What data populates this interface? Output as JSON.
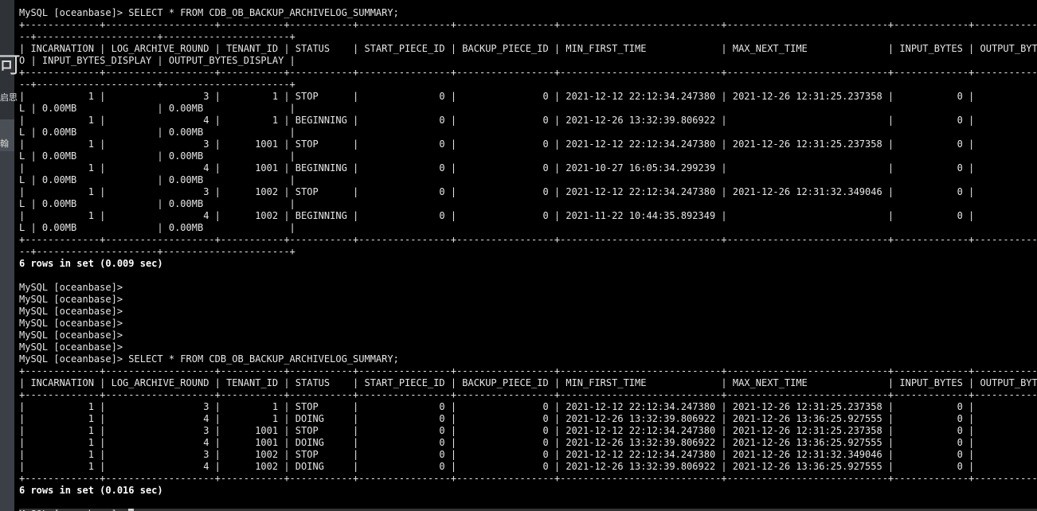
{
  "colors": {
    "background": "#000000",
    "text": "#e6e6e6",
    "left_strip": "#3a3f44",
    "highlight_row": "#333333"
  },
  "left_strip": {
    "glyph_1": "可",
    "glyph_2": "启思",
    "glyph_3": "翰"
  },
  "terminal": {
    "lines": [
      "MySQL [oceanbase]> SELECT * FROM CDB_OB_BACKUP_ARCHIVELOG_SUMMARY;",
      "+-------------+-------------------+-----------+-----------+----------------+-----------------+----------------------------+----------------------------+-------------+--------------+----",
      "--+---------------------+----------------------+",
      "| INCARNATION | LOG_ARCHIVE_ROUND | TENANT_ID | STATUS    | START_PIECE_ID | BACKUP_PIECE_ID | MIN_FIRST_TIME             | MAX_NEXT_TIME              | INPUT_BYTES | OUTPUT_BYTES | C",
      "O | INPUT_BYTES_DISPLAY | OUTPUT_BYTES_DISPLAY |",
      "+-------------+-------------------+-----------+-----------+----------------+-----------------+----------------------------+----------------------------+-------------+--------------+----",
      "--+---------------------+----------------------+",
      "|           1 |                 3 |         1 | STOP      |              0 |               0 | 2021-12-12 22:12:34.247380 | 2021-12-26 12:31:25.237358 |           0 |            0 |",
      "L | 0.00MB              | 0.00MB               |",
      "|           1 |                 4 |         1 | BEGINNING |              0 |               0 | 2021-12-26 13:32:39.806922 |                            |           0 |            0 |",
      "L | 0.00MB              | 0.00MB               |",
      "|           1 |                 3 |      1001 | STOP      |              0 |               0 | 2021-12-12 22:12:34.247380 | 2021-12-26 12:31:25.237358 |           0 |            0 |",
      "L | 0.00MB              | 0.00MB               |",
      "|           1 |                 4 |      1001 | BEGINNING |              0 |               0 | 2021-10-27 16:05:34.299239 |                            |           0 |            0 |",
      "L | 0.00MB              | 0.00MB               |",
      "|           1 |                 3 |      1002 | STOP      |              0 |               0 | 2021-12-12 22:12:34.247380 | 2021-12-26 12:31:32.349046 |           0 |            0 |",
      "L | 0.00MB              | 0.00MB               |",
      "|           1 |                 4 |      1002 | BEGINNING |              0 |               0 | 2021-11-22 10:44:35.892349 |                            |           0 |            0 |",
      "L | 0.00MB              | 0.00MB               |",
      "+-------------+-------------------+-----------+-----------+----------------+-----------------+----------------------------+----------------------------+-------------+--------------+----",
      "--+---------------------+----------------------+",
      "6 rows in set (0.009 sec)",
      "",
      "MySQL [oceanbase]>",
      "MySQL [oceanbase]>",
      "MySQL [oceanbase]>",
      "MySQL [oceanbase]>",
      "MySQL [oceanbase]>",
      "MySQL [oceanbase]>",
      "MySQL [oceanbase]> SELECT * FROM CDB_OB_BACKUP_ARCHIVELOG_SUMMARY;",
      "+-------------+-------------------+-----------+-----------+----------------+-----------------+----------------------------+----------------------------+-------------+--------------+-----",
      "| INCARNATION | LOG_ARCHIVE_ROUND | TENANT_ID | STATUS    | START_PIECE_ID | BACKUP_PIECE_ID | MIN_FIRST_TIME             | MAX_NEXT_TIME              | INPUT_BYTES | OUTPUT_BYTES | COMP",
      "+-------------+-------------------+-----------+-----------+----------------+-----------------+----------------------------+----------------------------+-------------+--------------+-----",
      "|           1 |                 3 |         1 | STOP      |              0 |               0 | 2021-12-12 22:12:34.247380 | 2021-12-26 12:31:25.237358 |           0 |            0 |",
      "|           1 |                 4 |         1 | DOING     |              0 |               0 | 2021-12-26 13:32:39.806922 | 2021-12-26 13:36:25.927555 |           0 |            0 |",
      "|           1 |                 3 |      1001 | STOP      |              0 |               0 | 2021-12-12 22:12:34.247380 | 2021-12-26 12:31:25.237358 |           0 |            0 |",
      "|           1 |                 4 |      1001 | DOING     |              0 |               0 | 2021-12-26 13:32:39.806922 | 2021-12-26 13:36:25.927555 |           0 |            0 |",
      "|           1 |                 3 |      1002 | STOP      |              0 |               0 | 2021-12-12 22:12:34.247380 | 2021-12-26 12:31:32.349046 |           0 |            0 |",
      "|           1 |                 4 |      1002 | DOING     |              0 |               0 | 2021-12-26 13:32:39.806922 | 2021-12-26 13:36:25.927555 |           0 |            0 |",
      "+-------------+-------------------+-----------+-----------+----------------+-----------------+----------------------------+----------------------------+-------------+--------------+-----",
      "6 rows in set (0.016 sec)",
      "",
      "MySQL [oceanbase]> "
    ],
    "bold_line_indices": [
      21,
      40
    ],
    "highlight_line_index": 42,
    "cursor_line_index": 42
  }
}
